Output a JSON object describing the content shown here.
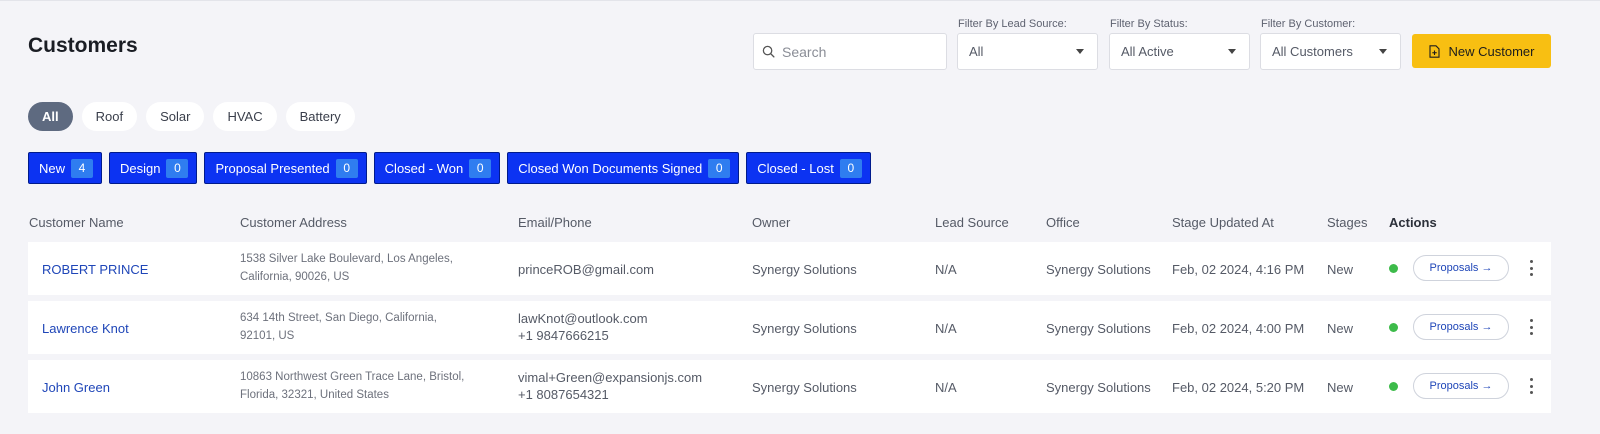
{
  "page": {
    "title": "Customers"
  },
  "search": {
    "placeholder": "Search"
  },
  "filters": {
    "lead_source": {
      "label": "Filter By Lead Source:",
      "value": "All"
    },
    "status": {
      "label": "Filter By Status:",
      "value": "All Active"
    },
    "customer": {
      "label": "Filter By Customer:",
      "value": "All Customers"
    }
  },
  "new_customer_label": "New Customer",
  "categories": [
    "All",
    "Roof",
    "Solar",
    "HVAC",
    "Battery"
  ],
  "stages": [
    {
      "label": "New",
      "count": "4"
    },
    {
      "label": "Design",
      "count": "0"
    },
    {
      "label": "Proposal Presented",
      "count": "0"
    },
    {
      "label": "Closed - Won",
      "count": "0"
    },
    {
      "label": "Closed Won Documents Signed",
      "count": "0"
    },
    {
      "label": "Closed - Lost",
      "count": "0"
    }
  ],
  "table": {
    "headers": {
      "name": "Customer Name",
      "address": "Customer Address",
      "email": "Email/Phone",
      "owner": "Owner",
      "lead": "Lead Source",
      "office": "Office",
      "updated": "Stage Updated At",
      "stages": "Stages",
      "actions": "Actions"
    },
    "proposals_label": "Proposals →",
    "rows": [
      {
        "name": "ROBERT PRINCE",
        "address_1": "1538 Silver Lake Boulevard, Los Angeles,",
        "address_2": "California, 90026, US",
        "email": "princeROB@gmail.com",
        "phone": "",
        "owner": "Synergy Solutions",
        "lead": "N/A",
        "office": "Synergy Solutions",
        "updated": "Feb, 02 2024, 4:16 PM",
        "stage": "New"
      },
      {
        "name": "Lawrence Knot",
        "address_1": "634 14th Street, San Diego, California,",
        "address_2": "92101, US",
        "email": "lawKnot@outlook.com",
        "phone": "+1 9847666215",
        "owner": "Synergy Solutions",
        "lead": "N/A",
        "office": "Synergy Solutions",
        "updated": "Feb, 02 2024, 4:00 PM",
        "stage": "New"
      },
      {
        "name": "John Green",
        "address_1": "10863 Northwest Green Trace Lane, Bristol,",
        "address_2": "Florida, 32321, United States",
        "email": "vimal+Green@expansionjs.com",
        "phone": "+1 8087654321",
        "owner": "Synergy Solutions",
        "lead": "N/A",
        "office": "Synergy Solutions",
        "updated": "Feb, 02 2024, 5:20 PM",
        "stage": "New"
      }
    ]
  },
  "colors": {
    "accent": "#f8bf12",
    "stage_blue": "#0c33f2",
    "status_green": "#3dbb4a",
    "link_blue": "#1f46b8"
  },
  "icons": [
    "search-icon",
    "chevron-down-icon",
    "document-plus-icon",
    "status-dot",
    "more-vertical-icon"
  ]
}
